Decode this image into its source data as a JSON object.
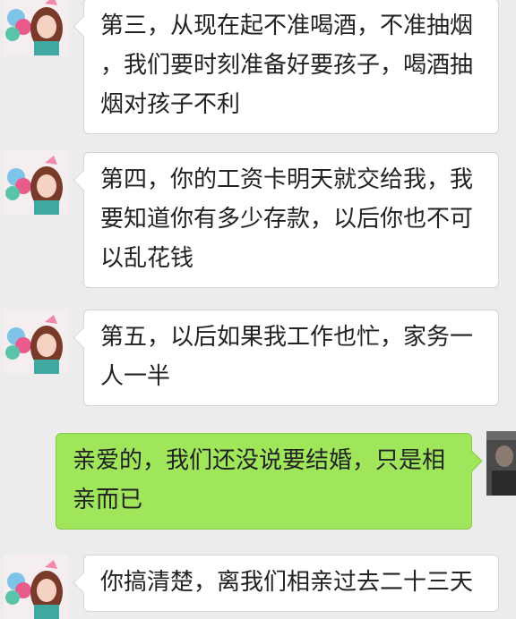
{
  "messages": [
    {
      "side": "in",
      "lines": [
        "第三，从现在起不准喝酒，不准抽烟",
        "，我们要时刻准备好要孩子，喝酒抽",
        "烟对孩子不利"
      ]
    },
    {
      "side": "in",
      "lines": [
        "第四，你的工资卡明天就交给我，我",
        "要知道你有多少存款，以后你也不可",
        "以乱花钱"
      ]
    },
    {
      "side": "in",
      "lines": [
        "第五，以后如果我工作也忙，家务一",
        "人一半"
      ]
    },
    {
      "side": "out",
      "lines": [
        "亲爱的，我们还没说要结婚，只是相",
        "亲而已"
      ]
    },
    {
      "side": "in",
      "lines": [
        "你搞清楚，离我们相亲过去二十三天"
      ]
    }
  ],
  "colors": {
    "background": "#ececec",
    "incoming_bubble": "#ffffff",
    "outgoing_bubble": "#9fe65a"
  }
}
